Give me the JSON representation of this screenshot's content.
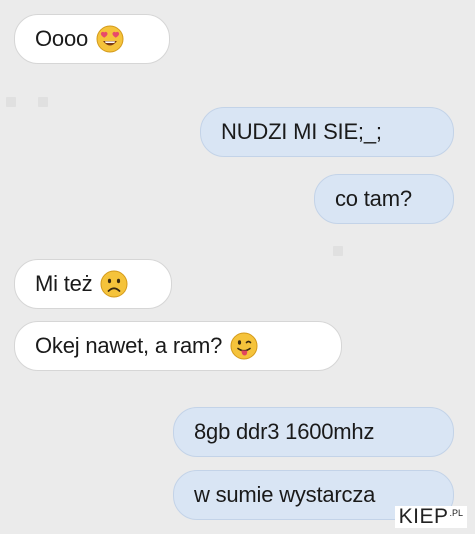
{
  "messages": [
    {
      "text": "Oooo",
      "emoji": "heart-eyes-emoji"
    },
    {
      "text": "NUDZI MI SIE;_;"
    },
    {
      "text": "co tam?"
    },
    {
      "text": "Mi też",
      "emoji": "sad-face-emoji"
    },
    {
      "text": "Okej nawet, a ram?",
      "emoji": "tongue-out-emoji"
    },
    {
      "text": "8gb ddr3 1600mhz"
    },
    {
      "text": "w sumie wystarcza"
    }
  ],
  "watermark": {
    "main": "KIEP",
    "tld": ".PL"
  },
  "colors": {
    "background": "#ebebeb",
    "incoming_bubble": "#ffffff",
    "outgoing_bubble": "#d9e5f4"
  }
}
